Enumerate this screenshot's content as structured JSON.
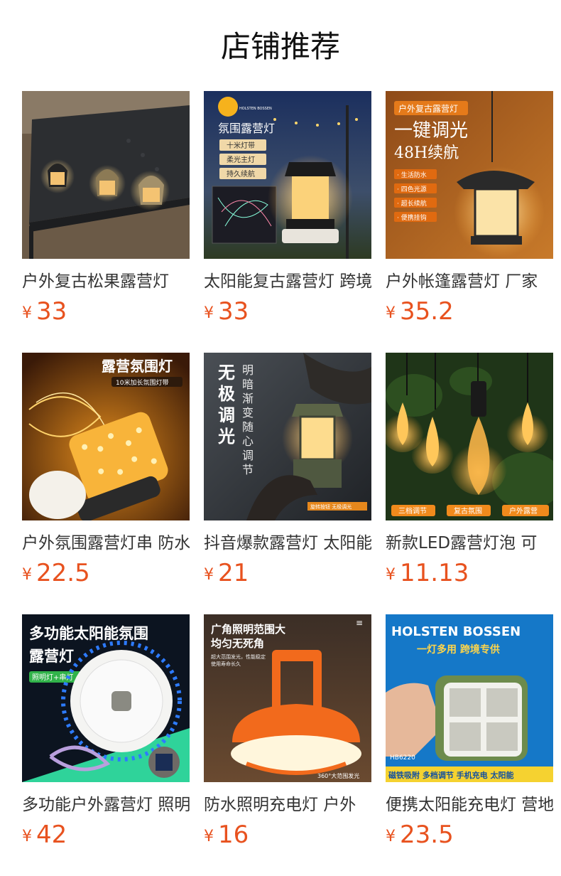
{
  "page": {
    "title": "店铺推荐",
    "currency": "¥"
  },
  "products": [
    {
      "name": "户外复古松果露营灯",
      "price": "33",
      "image_text": []
    },
    {
      "name": "太阳能复古露营灯 跨境",
      "price": "33",
      "image_text": [
        "氛围露营灯",
        "十米灯带",
        "柔光主灯",
        "持久续航",
        "HOLSTEN BOSSEN"
      ]
    },
    {
      "name": "户外帐篷露营灯 厂家",
      "price": "35.2",
      "image_text": [
        "户外复古露营灯",
        "一键调光",
        "48H续航",
        "· 生活防水",
        "· 四色光源",
        "· 超长续航",
        "· 便携挂钩"
      ]
    },
    {
      "name": "户外氛围露营灯串 防水",
      "price": "22.5",
      "image_text": [
        "露营氛围灯",
        "10米加长氛围灯带"
      ]
    },
    {
      "name": "抖音爆款露营灯 太阳能",
      "price": "21",
      "image_text": [
        "无极调光",
        "明暗渐变随心调节",
        "旋转按钮 无极调光"
      ]
    },
    {
      "name": "新款LED露营灯泡 可",
      "price": "11.13",
      "image_text": [
        "三档调节",
        "复古氛围",
        "户外露营"
      ]
    },
    {
      "name": "多功能户外露营灯 照明",
      "price": "42",
      "image_text": [
        "多功能太阳能氛围",
        "露营灯",
        "照明灯+串灯"
      ]
    },
    {
      "name": "防水照明充电灯 户外",
      "price": "16",
      "image_text": [
        "广角照明范围大",
        "均匀无死角",
        "超大范围发光，性能稳定",
        "使用寿命长久",
        "360°大范围发光"
      ]
    },
    {
      "name": "便携太阳能充电灯 营地",
      "price": "23.5",
      "image_text": [
        "HOLSTEN BOSSEN",
        "一灯多用 跨境专供",
        "HB6220",
        "磁铁吸附 多档调节 手机充电 太阳能"
      ]
    }
  ]
}
